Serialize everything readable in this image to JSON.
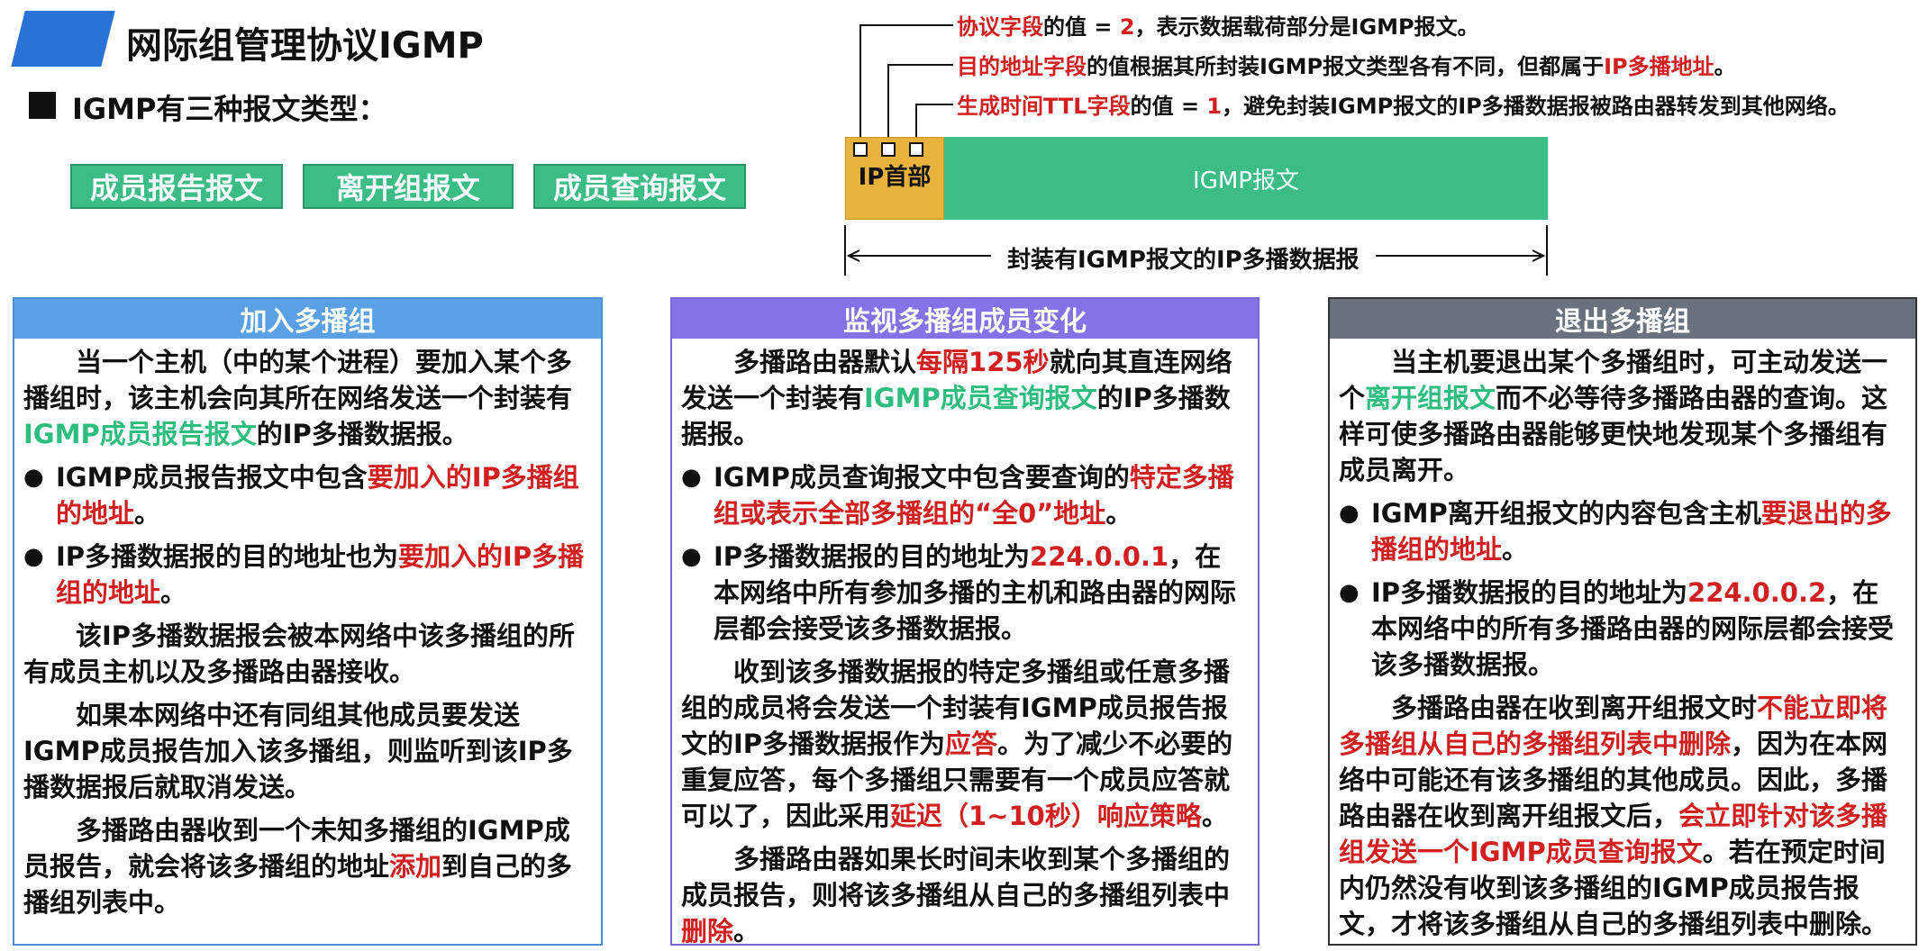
{
  "header": {
    "title": "网际组管理协议IGMP",
    "types_heading": "IGMP有三种报文类型：",
    "types": [
      "成员报告报文",
      "离开组报文",
      "成员查询报文"
    ]
  },
  "diagram": {
    "notes": [
      {
        "a": "协议字段",
        "b": "的值 = ",
        "c": "2",
        "d": "，表示数据载荷部分是IGMP报文。",
        "e": ""
      },
      {
        "a": "目的地址字段",
        "b": "的值根据其所封装IGMP报文类型各有不同，但都属于",
        "c": "IP多播地址",
        "d": "。",
        "e": ""
      },
      {
        "a": "生成时间TTL字段",
        "b": "的值 = ",
        "c": "1",
        "d": "，避免封装IGMP报文的IP多播数据报被路由器转发到其他网络。",
        "e": ""
      }
    ],
    "ip_header_label": "IP首部",
    "igmp_label": "IGMP报文",
    "dimension_label": "封装有IGMP报文的IP多播数据报"
  },
  "panels": {
    "join": {
      "title": "加入多播组",
      "p1": [
        "当一个主机（中的某个进程）要加入某个多播组时，该主机会向其所在网络发送一个封装有",
        "IGMP成员报告报文",
        "的IP多播数据报。"
      ],
      "b1": [
        "IGMP成员报告报文中包含",
        "要加入的IP多播组的地址",
        "。"
      ],
      "b2": [
        "IP多播数据报的目的地址也为",
        "要加入的IP多播组的地址",
        "。"
      ],
      "p2": "该IP多播数据报会被本网络中该多播组的所有成员主机以及多播路由器接收。",
      "p3": "如果本网络中还有同组其他成员要发送IGMP成员报告加入该多播组，则监听到该IP多播数据报后就取消发送。",
      "p4": [
        "多播路由器收到一个未知多播组的IGMP成员报告，就会将该多播组的地址",
        "添加",
        "到自己的多播组列表中。"
      ]
    },
    "monitor": {
      "title": "监视多播组成员变化",
      "p1": [
        "多播路由器默认",
        "每隔125秒",
        "就向其直连网络发送一个封装有",
        "IGMP成员查询报文",
        "的IP多播数据报。"
      ],
      "b1": [
        "IGMP成员查询报文中包含要查询的",
        "特定多播组或表示全部多播组的“全0”地址",
        "。"
      ],
      "b2": [
        "IP多播数据报的目的地址为",
        "224.0.0.1",
        "，在本网络中所有参加多播的主机和路由器的网际层都会接受该多播数据报。"
      ],
      "p2": [
        "收到该多播数据报的特定多播组或任意多播组的成员将会发送一个封装有IGMP成员报告报文的IP多播数据报作为",
        "应答",
        "。为了减少不必要的重复应答，每个多播组只需要有一个成员应答就可以了，因此采用",
        "延迟（1~10秒）响应策略",
        "。"
      ],
      "p3": [
        "多播路由器如果长时间未收到某个多播组的成员报告，则将该多播组从自己的多播组列表中",
        "删除",
        "。"
      ]
    },
    "leave": {
      "title": "退出多播组",
      "p1": [
        "当主机要退出某个多播组时，可主动发送一个",
        "离开组报文",
        "而不必等待多播路由器的查询。这样可使多播路由器能够更快地发现某个多播组有成员离开。"
      ],
      "b1": [
        "IGMP离开组报文的内容包含主机",
        "要退出的多播组的地址",
        "。"
      ],
      "b2": [
        "IP多播数据报的目的地址为",
        "224.0.0.2",
        "，在本网络中的所有多播路由器的网际层都会接受该多播数据报。"
      ],
      "p2": [
        "多播路由器在收到离开组报文时",
        "不能立即将多播组从自己的多播组列表中删除",
        "，因为在本网络中可能还有该多播组的其他成员。因此，多播路由器在收到离开组报文后，",
        "会立即针对该多播组发送一个IGMP成员查询报文",
        "。若在预定时间内仍然没有收到该多播组的IGMP成员报告报文，才将该多播组从自己的多播组列表中删除。"
      ]
    }
  },
  "colors": {
    "accent_red": "#d21f1f",
    "accent_green": "#2fbd7f",
    "title_blue": "#2a72d6",
    "join_header": "#5aa0e4",
    "monitor_header": "#8472e6",
    "leave_header": "#6a7280",
    "ip_header_fill": "#e8b23c",
    "igmp_fill": "#3cbd86"
  }
}
